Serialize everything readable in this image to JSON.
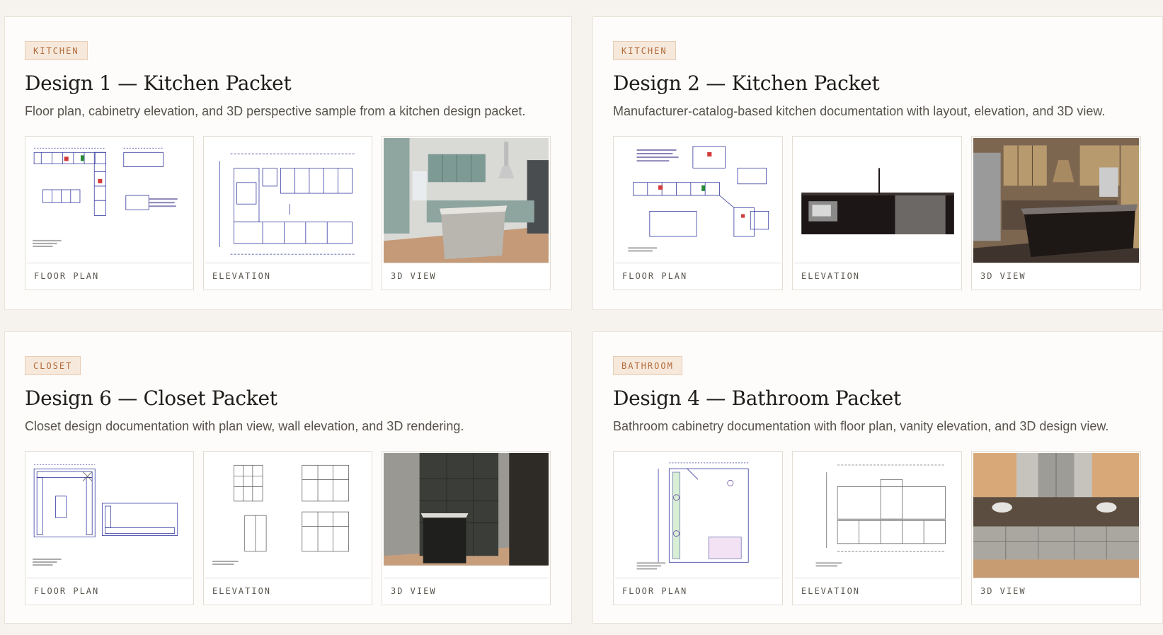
{
  "cards": [
    {
      "badge": "KITCHEN",
      "title": "Design 1 — Kitchen Packet",
      "description": "Floor plan, cabinetry elevation, and 3D perspective sample from a kitchen design packet.",
      "thumbs": [
        {
          "caption": "FLOOR PLAN"
        },
        {
          "caption": "ELEVATION"
        },
        {
          "caption": "3D VIEW"
        }
      ]
    },
    {
      "badge": "KITCHEN",
      "title": "Design 2 — Kitchen Packet",
      "description": "Manufacturer-catalog-based kitchen documentation with layout, elevation, and 3D view.",
      "thumbs": [
        {
          "caption": "FLOOR PLAN"
        },
        {
          "caption": "ELEVATION"
        },
        {
          "caption": "3D VIEW"
        }
      ]
    },
    {
      "badge": "CLOSET",
      "title": "Design 6 — Closet Packet",
      "description": "Closet design documentation with plan view, wall elevation, and 3D rendering.",
      "thumbs": [
        {
          "caption": "FLOOR PLAN"
        },
        {
          "caption": "ELEVATION"
        },
        {
          "caption": "3D VIEW"
        }
      ]
    },
    {
      "badge": "BATHROOM",
      "title": "Design 4 — Bathroom Packet",
      "description": "Bathroom cabinetry documentation with floor plan, vanity elevation, and 3D design view.",
      "thumbs": [
        {
          "caption": "FLOOR PLAN"
        },
        {
          "caption": "ELEVATION"
        },
        {
          "caption": "3D VIEW"
        }
      ]
    }
  ],
  "colors": {
    "page_bg": "#f6f3ee",
    "card_bg": "#fdfcfa",
    "badge_text": "#b36a3a",
    "badge_bg": "#f6e9dc",
    "line_art": "#3a3fa0"
  }
}
